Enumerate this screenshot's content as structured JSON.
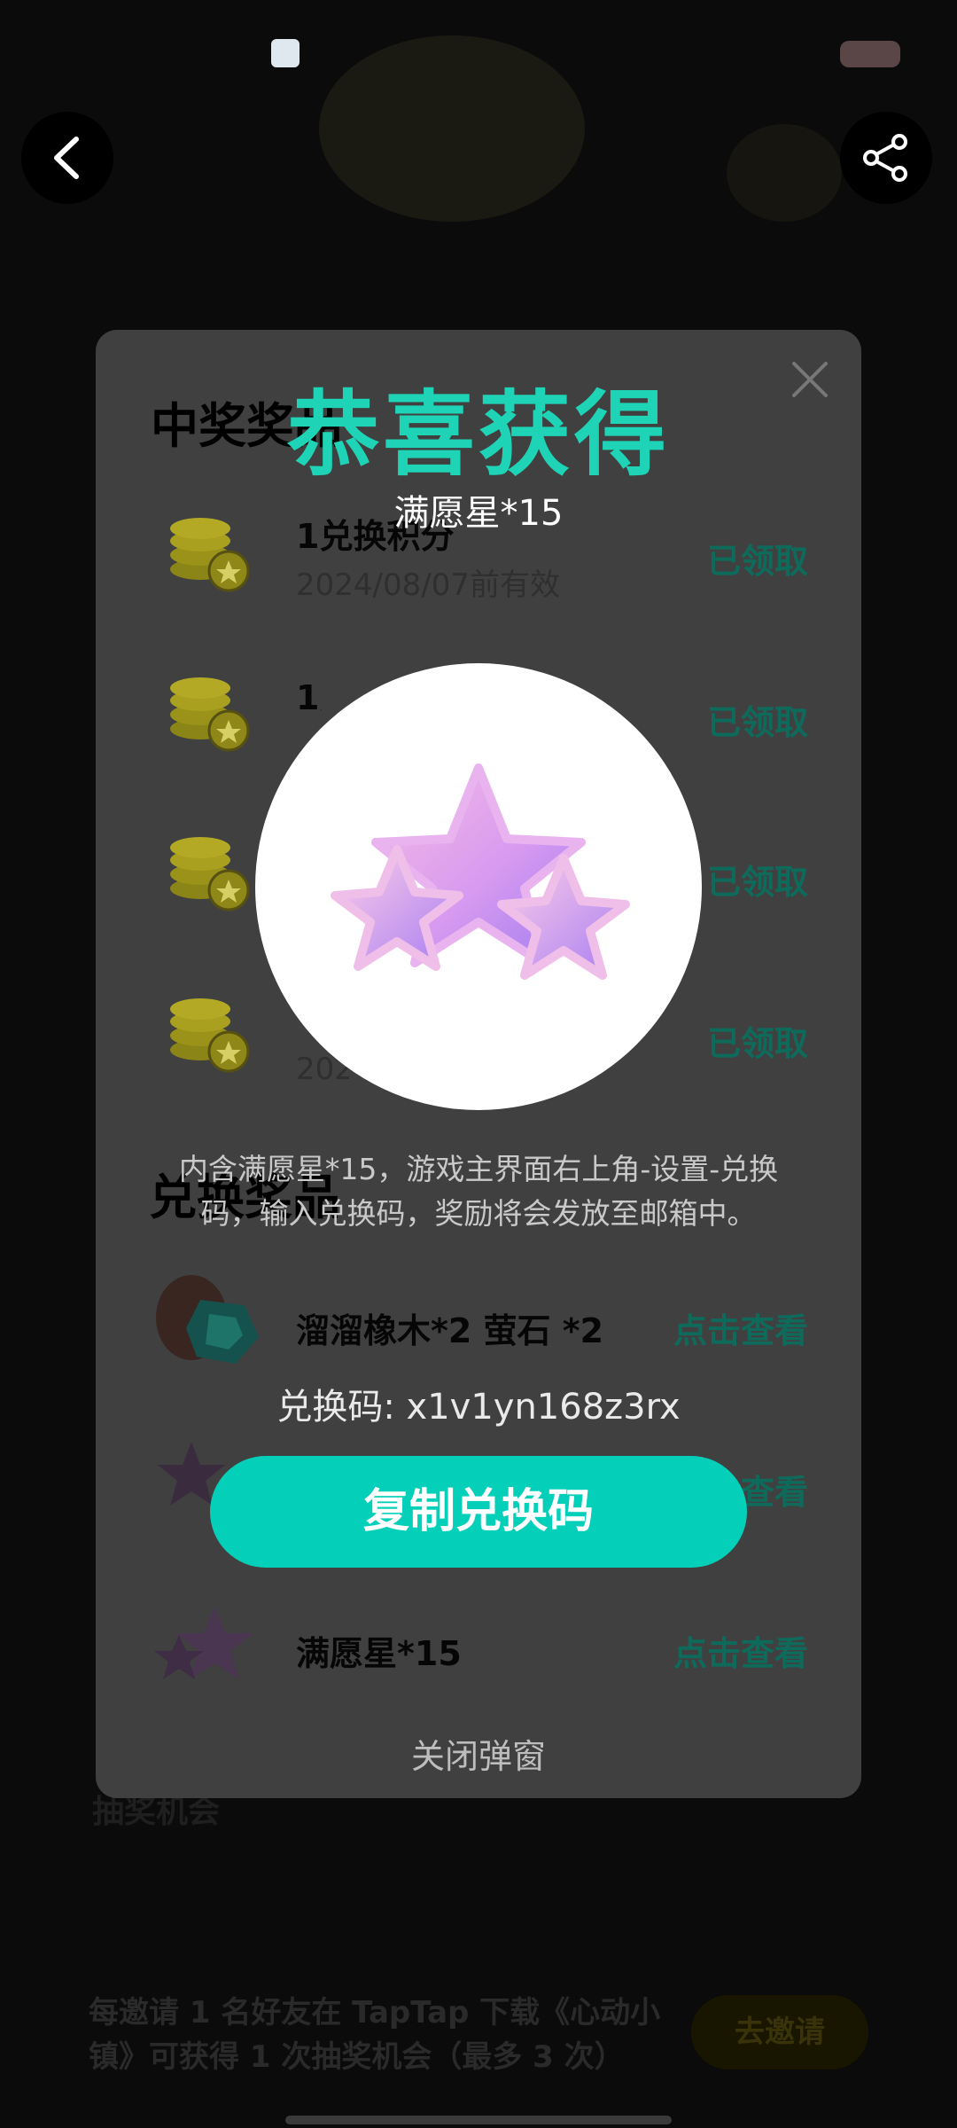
{
  "background": {
    "footer_text": "每邀请 1 名好友在 TapTap 下载《心动小镇》可获得 1 次抽奖机会（最多 3 次）",
    "footer_button": "去邀请",
    "chance_label": "抽奖机会"
  },
  "list": {
    "prizes_title": "中奖奖品",
    "exchange_title": "兑换奖品",
    "prizes": [
      {
        "title": "1兑换积分",
        "sub": "2024/08/07前有效",
        "action": "已领取"
      },
      {
        "title": "1兑换积分",
        "sub": "2024/08/07前有效",
        "action": "已领取"
      },
      {
        "title": "",
        "sub": "",
        "action": "已领取"
      },
      {
        "title": "",
        "sub": "2024/08/07前有效",
        "action": "已领取"
      }
    ],
    "exchange": [
      {
        "title": "溜溜橡木*2 萤石 *2",
        "action": "点击查看"
      },
      {
        "title": "",
        "action": "点击查看"
      },
      {
        "title": "满愿星*15",
        "action": "点击查看"
      }
    ]
  },
  "modal": {
    "heading": "恭喜获得",
    "reward_name": "满愿星*15",
    "description": "内含满愿星*15，游戏主界面右上角-设置-兑换码，输入兑换码，奖励将会发放至邮箱中。",
    "code_label": "兑换码: x1v1yn168z3rx",
    "copy_button": "复制兑换码",
    "close_text": "关闭弹窗"
  },
  "colors": {
    "accent": "#04cfb9",
    "heading": "#1ed3b6"
  },
  "icons": {
    "back": "chevron-left-icon",
    "share": "share-icon",
    "close": "close-icon",
    "coin": "coin-stack-icon",
    "star": "star-cluster-icon"
  }
}
